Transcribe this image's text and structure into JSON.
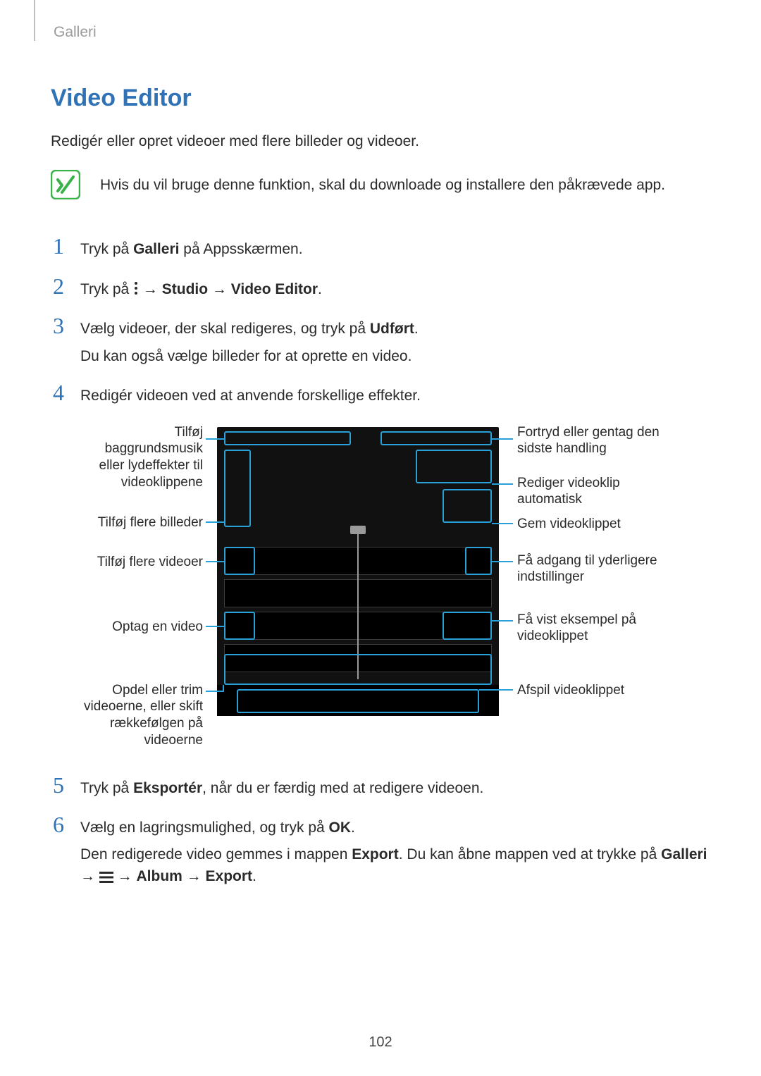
{
  "breadcrumb": "Galleri",
  "title": "Video Editor",
  "intro": "Redigér eller opret videoer med flere billeder og videoer.",
  "note": {
    "text": "Hvis du vil bruge denne funktion, skal du downloade og installere den påkrævede app."
  },
  "steps": {
    "s1": {
      "num": "1",
      "a": "Tryk på ",
      "b": "Galleri",
      "c": " på Appsskærmen."
    },
    "s2": {
      "num": "2",
      "a": "Tryk på ",
      "arrow1": " → ",
      "b": "Studio",
      "arrow2": " → ",
      "c": "Video Editor",
      "d": "."
    },
    "s3": {
      "num": "3",
      "a": "Vælg videoer, der skal redigeres, og tryk på ",
      "b": "Udført",
      "c": ".",
      "line2": "Du kan også vælge billeder for at oprette en video."
    },
    "s4": {
      "num": "4",
      "a": "Redigér videoen ved at anvende forskellige effekter."
    },
    "s5": {
      "num": "5",
      "a": "Tryk på ",
      "b": "Eksportér",
      "c": ", når du er færdig med at redigere videoen."
    },
    "s6": {
      "num": "6",
      "a": "Vælg en lagringsmulighed, og tryk på ",
      "b": "OK",
      "c": ".",
      "l2a": "Den redigerede video gemmes i mappen ",
      "l2b": "Export",
      "l2c": ". Du kan åbne mappen ved at trykke på ",
      "l2d": "Galleri",
      "l2arrow1": " → ",
      "l2e": "Album",
      "l2arrow2": " → ",
      "l2f": "Export",
      "l2g": "."
    }
  },
  "diagram": {
    "left": {
      "l1": "Tilføj baggrundsmusik eller lydeffekter til videoklippene",
      "l2": "Tilføj flere billeder",
      "l3": "Tilføj flere videoer",
      "l4": "Optag en video",
      "l5": "Opdel eller trim videoerne, eller skift rækkefølgen på videoerne"
    },
    "right": {
      "r1": "Fortryd eller gentag den sidste handling",
      "r2": "Rediger videoklip automatisk",
      "r3": "Gem videoklippet",
      "r4": "Få adgang til yderligere indstillinger",
      "r5": "Få vist eksempel på videoklippet",
      "r6": "Afspil videoklippet"
    }
  },
  "page_number": "102"
}
